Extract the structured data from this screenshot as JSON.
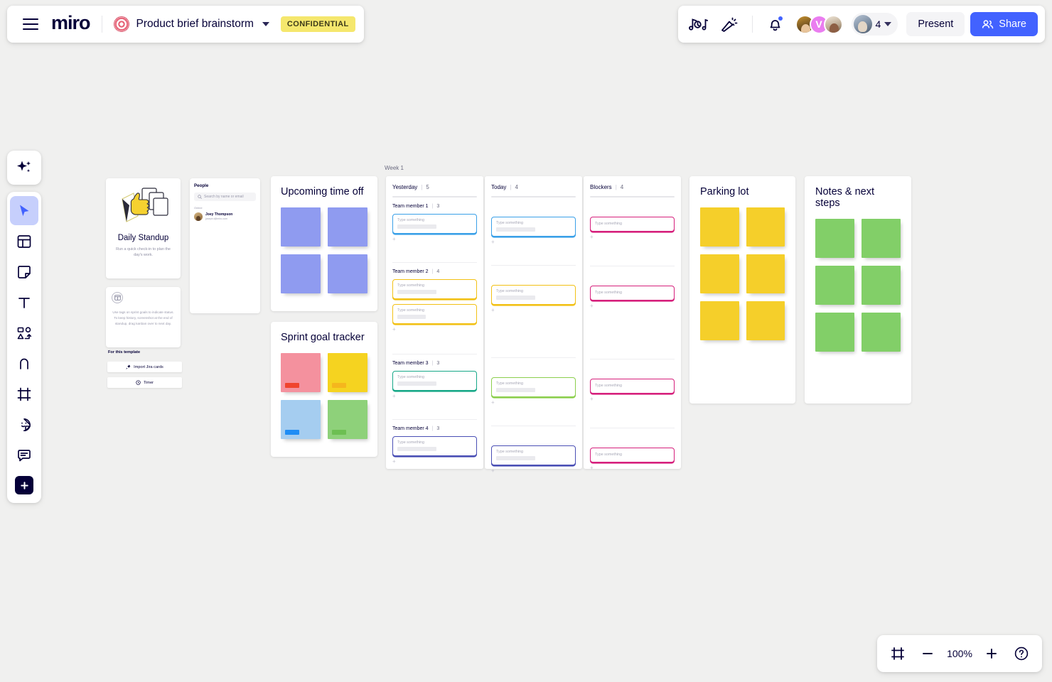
{
  "header": {
    "menu_icon": "hamburger-icon",
    "logo": "miro",
    "board_title": "Product brief brainstorm",
    "board_icon": "target-board-icon",
    "badge": "CONFIDENTIAL",
    "music_icon": "music-notes-icon",
    "celebrate_icon": "party-popper-icon",
    "bell_icon": "notification-bell-icon",
    "collaborator_initial": "V",
    "collaborator_count": "4",
    "present_label": "Present",
    "share_label": "Share",
    "accent_color": "#4262ff",
    "badge_color": "#f5e76d"
  },
  "toolbar": {
    "items": [
      {
        "name": "ai-tool",
        "icon": "sparkles-icon"
      },
      {
        "name": "select-tool",
        "icon": "cursor-icon",
        "active": true
      },
      {
        "name": "templates-tool",
        "icon": "templates-icon"
      },
      {
        "name": "sticky-note-tool",
        "icon": "sticky-note-icon"
      },
      {
        "name": "text-tool",
        "icon": "text-icon"
      },
      {
        "name": "shapes-tool",
        "icon": "shapes-connector-icon"
      },
      {
        "name": "pen-tool",
        "icon": "pen-icon"
      },
      {
        "name": "frame-tool",
        "icon": "frame-icon"
      },
      {
        "name": "sticker-tool",
        "icon": "sticker-smiley-icon"
      },
      {
        "name": "comment-tool",
        "icon": "comment-icon"
      },
      {
        "name": "more-apps-tool",
        "icon": "plus-square-icon"
      }
    ]
  },
  "standup_card": {
    "title": "Daily Standup",
    "description": "Run a quick check-in to plan the day's work."
  },
  "tip_card": {
    "icon": "kanban-board-icon",
    "text": "Use tags on sprint goals to indicate status. To keep history, screenshot at the end of standup, drag kanban over to next day.",
    "section_label": "For this template",
    "buttons": [
      {
        "label": "Import Jira cards",
        "icon": "pin-icon"
      },
      {
        "label": "Timer",
        "icon": "clock-icon"
      }
    ]
  },
  "people_panel": {
    "title": "People",
    "search_placeholder": "Search by name or email",
    "search_icon": "search-icon",
    "section_label": "Online",
    "members": [
      {
        "name": "Joey Thompson",
        "email": "joseph.t@miro.com"
      }
    ]
  },
  "timeoff_panel": {
    "title": "Upcoming time off",
    "sticky_color": "#8f9bf0",
    "stickies": [
      "",
      "",
      "",
      ""
    ]
  },
  "sprint_panel": {
    "title": "Sprint goal tracker",
    "stickies": [
      {
        "color": "#f4919e",
        "tag": "#f0442e"
      },
      {
        "color": "#f5d320",
        "tag": "#f5b61d"
      },
      {
        "color": "#a5cdf0",
        "tag": "#1f8df5"
      },
      {
        "color": "#8ed17a",
        "tag": "#6dbf52"
      }
    ]
  },
  "parking_panel": {
    "title": "Parking lot",
    "sticky_color": "#f5cf2a",
    "stickies": [
      "",
      "",
      "",
      "",
      "",
      ""
    ]
  },
  "notes_panel": {
    "title": "Notes & next steps",
    "sticky_color": "#82cf68",
    "stickies": [
      "",
      "",
      "",
      "",
      "",
      ""
    ]
  },
  "kanban": {
    "frame_label": "Week 1",
    "card_placeholder": "Type something",
    "add_label": "+",
    "columns": [
      {
        "name": "Yesterday",
        "count": "5"
      },
      {
        "name": "Today",
        "count": "4"
      },
      {
        "name": "Blockers",
        "count": "4"
      }
    ],
    "lanes": [
      {
        "name": "Team member 1",
        "count": "3",
        "color": "#3aa0e8",
        "yesterday": 1,
        "today": 1,
        "blockers": 1
      },
      {
        "name": "Team member 2",
        "count": "4",
        "color": "#f2c116",
        "yesterday": 2,
        "today": 1,
        "blockers": 1
      },
      {
        "name": "Team member 3",
        "count": "3",
        "color": "#17a888",
        "today_color": "#8ccf4d",
        "yesterday": 1,
        "today": 1,
        "blockers": 1
      },
      {
        "name": "Team member 4",
        "count": "3",
        "color": "#4a4fb5",
        "yesterday": 1,
        "today": 1,
        "blockers": 1
      }
    ],
    "blocker_color": "#d6207c"
  },
  "zoom_controls": {
    "fit_icon": "fit-to-screen-icon",
    "zoom_out_label": "−",
    "zoom_level": "100%",
    "zoom_in_label": "+",
    "help_label": "?"
  }
}
